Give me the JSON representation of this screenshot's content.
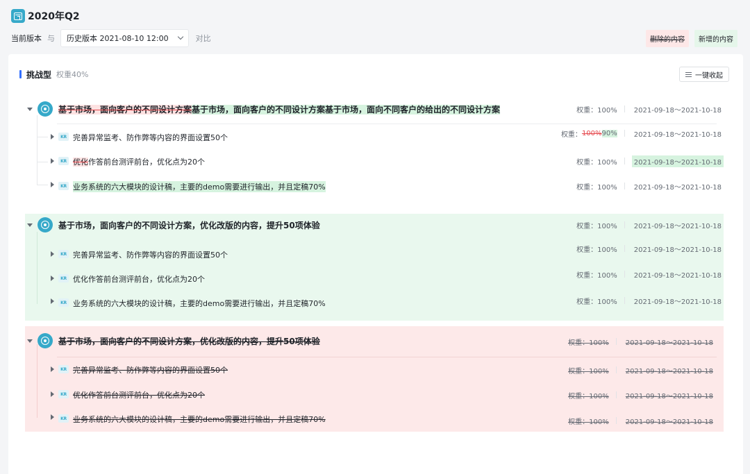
{
  "header": {
    "title": "2020年Q2"
  },
  "toolbar": {
    "current_version": "当前版本",
    "with": "与",
    "history_version": "历史版本 2021-08-10 12:00",
    "compare": "对比"
  },
  "legend": {
    "deleted": "删除的内容",
    "added": "新增的内容"
  },
  "section": {
    "title": "挑战型",
    "weight": "权重40%",
    "collapse_all": "一键收起"
  },
  "colors": {
    "accent": "#36a9c9",
    "added_bg": "#e9f8ee",
    "removed_bg": "#fde9e9",
    "primary": "#3370ff"
  },
  "groups": [
    {
      "status": "modified",
      "objective": {
        "deleted_part": "基于市场，面向客户的不同设计方案",
        "text": "基于市场，面向客户的不同设计方案基于市场，面向不同客户的给出的不同设计方案",
        "weight": "权重：100%",
        "date": "2021-09-18～2021-10-18"
      },
      "krs": [
        {
          "badge": "KR",
          "text": "完善异常监考、防作弊等内容的界面设置50个",
          "weight_label": "权重：",
          "weight_old": "100%",
          "weight_new": "90%",
          "date": "2021-09-18～2021-10-18"
        },
        {
          "badge": "KR",
          "deleted_part": "优化",
          "text": "作答前台测评前台，优化点为20个",
          "weight": "权重：100%",
          "date": "2021-09-18～2021-10-18"
        },
        {
          "badge": "KR",
          "text": "业务系统的六大模块的设计稿，主要的demo需要进行输出，并且定稿70%",
          "weight": "权重：100%",
          "date": "2021-09-18～2021-10-18"
        }
      ]
    },
    {
      "status": "added",
      "objective": {
        "text": "基于市场，面向客户的不同设计方案，优化改版的内容，提升50项体验",
        "weight": "权重：100%",
        "date": "2021-09-18～2021-10-18"
      },
      "krs": [
        {
          "badge": "KR",
          "text": "完善异常监考、防作弊等内容的界面设置50个",
          "weight": "权重：100%",
          "date": "2021-09-18～2021-10-18"
        },
        {
          "badge": "KR",
          "text": "优化作答前台测评前台，优化点为20个",
          "weight": "权重：100%",
          "date": "2021-09-18～2021-10-18"
        },
        {
          "badge": "KR",
          "text": "业务系统的六大模块的设计稿，主要的demo需要进行输出，并且定稿70%",
          "weight": "权重：100%",
          "date": "2021-09-18～2021-10-18"
        }
      ]
    },
    {
      "status": "removed",
      "objective": {
        "text": "基于市场，面向客户的不同设计方案，优化改版的内容，提升50项体验",
        "weight": "权重：100%",
        "date": "2021-09-18～2021-10-18"
      },
      "krs": [
        {
          "badge": "KR",
          "text": "完善异常监考、防作弊等内容的界面设置50个",
          "weight": "权重：100%",
          "date": "2021-09-18～2021-10-18"
        },
        {
          "badge": "KR",
          "text": "优化作答前台测评前台，优化点为20个",
          "weight": "权重：100%",
          "date": "2021-09-18～2021-10-18"
        },
        {
          "badge": "KR",
          "text": "业务系统的六大模块的设计稿，主要的demo需要进行输出，并且定稿70%",
          "weight": "权重：100%",
          "date": "2021-09-18～2021-10-18"
        }
      ]
    }
  ]
}
